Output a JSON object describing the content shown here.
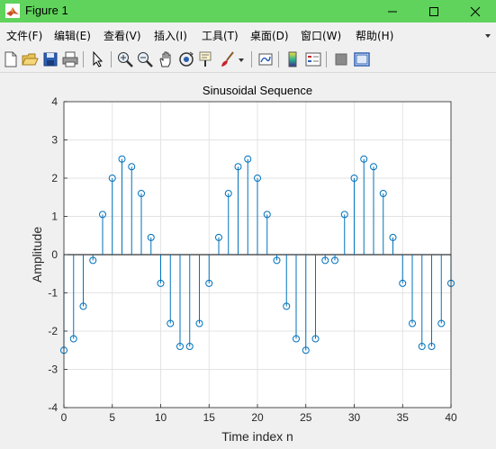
{
  "window": {
    "title": "Figure 1"
  },
  "menu": [
    "文件(F)",
    "编辑(E)",
    "查看(V)",
    "插入(I)",
    "工具(T)",
    "桌面(D)",
    "窗口(W)",
    "帮助(H)"
  ],
  "toolbar_icons": [
    "new-figure-icon",
    "open-file-icon",
    "save-icon",
    "print-icon",
    "pointer-icon",
    "zoom-in-icon",
    "zoom-out-icon",
    "pan-icon",
    "rotate-3d-icon",
    "data-cursor-icon",
    "brush-icon",
    "brush-dropdown-icon",
    "link-plot-icon",
    "colorbar-icon",
    "legend-icon",
    "hide-plot-tools-icon",
    "show-plot-tools-icon"
  ],
  "colors": {
    "titlebar": "#5fd35b",
    "stem": "#0072bd",
    "grid": "#e3e3e3"
  },
  "chart_data": {
    "type": "stem",
    "title": "Sinusoidal Sequence",
    "xlabel": "Time index n",
    "ylabel": "Amplitude",
    "xlim": [
      0,
      40
    ],
    "ylim": [
      -4,
      4
    ],
    "xticks": [
      0,
      5,
      10,
      15,
      20,
      25,
      30,
      35,
      40
    ],
    "yticks": [
      -4,
      -3,
      -2,
      -1,
      0,
      1,
      2,
      3,
      4
    ],
    "grid": true,
    "x": [
      0,
      1,
      2,
      3,
      4,
      5,
      6,
      7,
      8,
      9,
      10,
      11,
      12,
      13,
      14,
      15,
      16,
      17,
      18,
      19,
      20,
      21,
      22,
      23,
      24,
      25,
      26,
      27,
      28,
      29,
      30,
      31,
      32,
      33,
      34,
      35,
      36,
      37,
      38,
      39,
      40
    ],
    "y": [
      -2.5,
      -2.2,
      -1.35,
      -0.15,
      1.05,
      2.0,
      2.5,
      2.3,
      1.6,
      0.45,
      -0.75,
      -1.8,
      -2.4,
      -2.4,
      -1.8,
      -0.75,
      0.45,
      1.6,
      2.3,
      2.5,
      2.0,
      1.05,
      -0.15,
      -1.35,
      -2.2,
      -2.5,
      -2.2,
      -0.15,
      -0.15,
      1.05,
      2.0,
      2.5,
      2.3,
      1.6,
      0.45,
      -0.75,
      -1.8,
      -2.4,
      -2.4,
      -1.8,
      -0.75
    ]
  }
}
